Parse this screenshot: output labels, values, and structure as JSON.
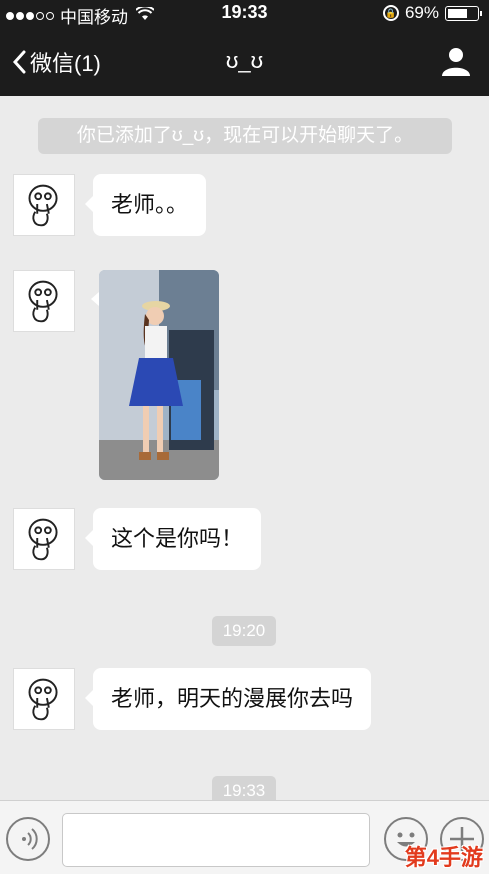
{
  "status_bar": {
    "carrier": "中国移动",
    "time": "19:33",
    "battery": "69%",
    "battery_level": 0.69
  },
  "navbar": {
    "back_label": "微信(1)",
    "title": "ʊ_ʊ",
    "profile_icon": "person-icon"
  },
  "chat": {
    "system_note": "你已添加了ʊ_ʊ，现在可以开始聊天了。",
    "messages": [
      {
        "type": "text",
        "text": "老师。。"
      },
      {
        "type": "image",
        "alt": "photo"
      },
      {
        "type": "text",
        "text": "这个是你吗！"
      },
      {
        "type": "time",
        "text": "19:20"
      },
      {
        "type": "text",
        "text": "老师，明天的漫展你去吗"
      },
      {
        "type": "time",
        "text": "19:33"
      }
    ]
  },
  "input_bar": {
    "voice_icon": "voice-icon",
    "emoji_icon": "emoji-icon",
    "plus_icon": "plus-icon"
  },
  "watermark": "第4手游"
}
